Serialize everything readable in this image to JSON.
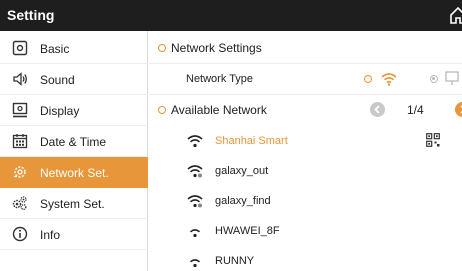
{
  "titlebar": {
    "title": "Setting",
    "home_icon": "home-icon"
  },
  "sidebar": {
    "items": [
      {
        "label": "Basic",
        "icon": "basic-icon"
      },
      {
        "label": "Sound",
        "icon": "speaker-icon"
      },
      {
        "label": "Display",
        "icon": "monitor-icon"
      },
      {
        "label": "Date & Time",
        "icon": "calendar-icon"
      },
      {
        "label": "Network Set.",
        "icon": "network-settings-icon",
        "active": true
      },
      {
        "label": "System Set.",
        "icon": "gears-icon"
      },
      {
        "label": "Info",
        "icon": "info-icon"
      }
    ]
  },
  "main": {
    "network_settings": {
      "label": "Network Settings"
    },
    "network_type": {
      "label": "Network Type",
      "selected": "wifi",
      "options": [
        "wifi",
        "wired"
      ]
    },
    "available": {
      "label": "Available Network",
      "page": "1/4"
    },
    "networks": [
      {
        "name": "Shanhai Smart",
        "connected": true,
        "locked": false,
        "qr": true
      },
      {
        "name": "galaxy_out",
        "connected": false,
        "locked": true
      },
      {
        "name": "galaxy_find",
        "connected": false,
        "locked": true
      },
      {
        "name": "HWAWEI_8F",
        "connected": false,
        "locked": false
      },
      {
        "name": "RUNNY",
        "connected": false,
        "locked": false
      }
    ]
  },
  "colors": {
    "accent": "#e7963a",
    "titlebar": "#1e1e1e",
    "disabled": "#c9c9c9"
  }
}
